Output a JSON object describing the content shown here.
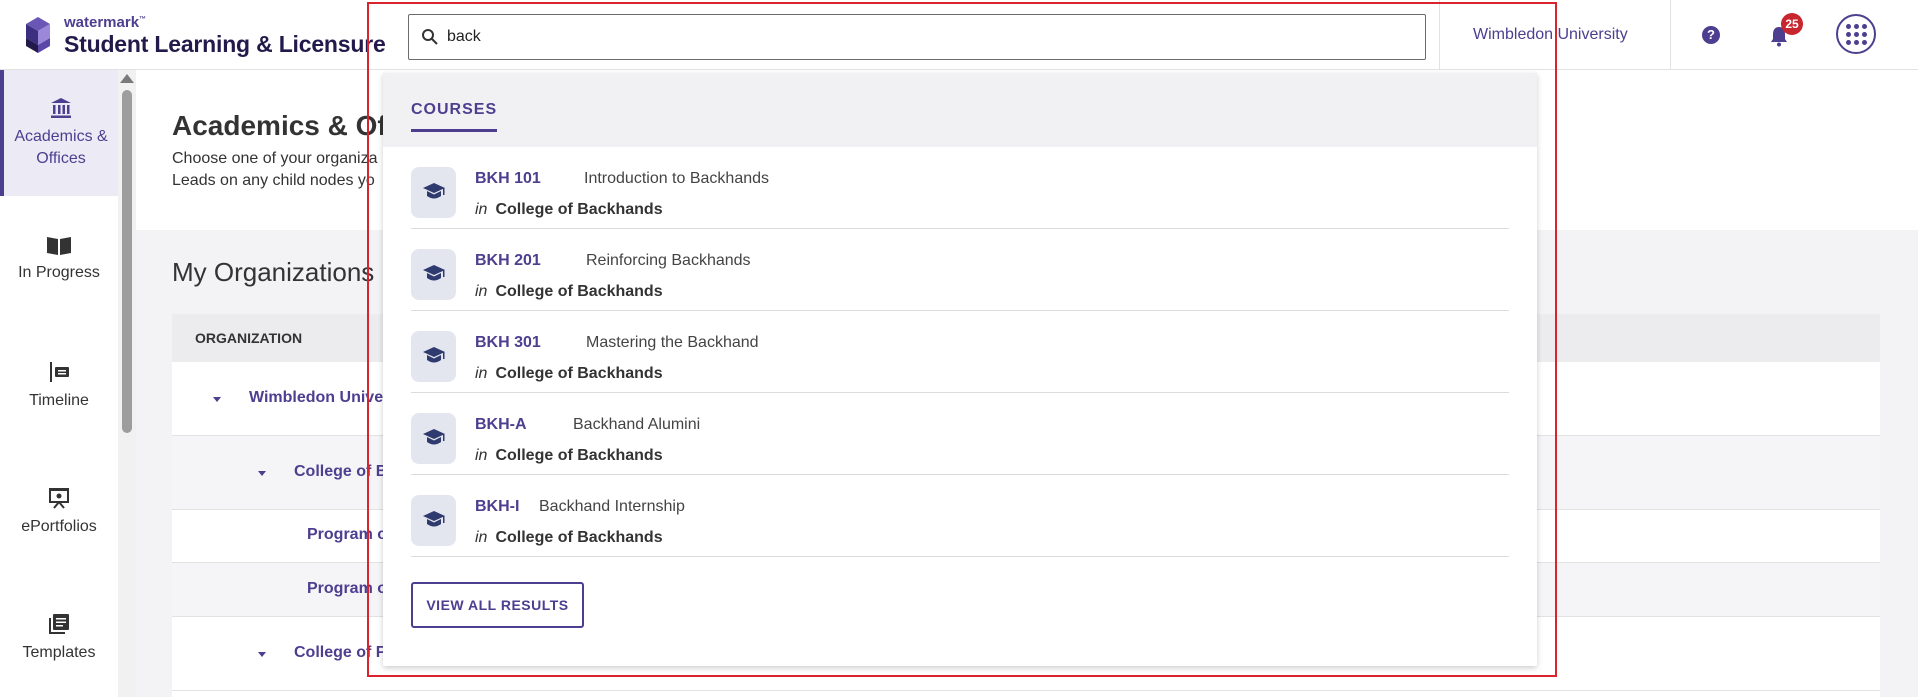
{
  "header": {
    "brand": "watermark",
    "brand_tm": "™",
    "product": "Student Learning & Licensure",
    "search_value": "back",
    "institution": "Wimbledon University",
    "help_icon": "question-circle-icon",
    "notification_count": "25",
    "apps_icon": "grid-apps-icon"
  },
  "sidebar": {
    "items": [
      {
        "label": "Academics & Offices",
        "icon": "institution-icon",
        "active": true
      },
      {
        "label": "In Progress",
        "icon": "open-book-icon"
      },
      {
        "label": "Timeline",
        "icon": "timeline-icon"
      },
      {
        "label": "ePortfolios",
        "icon": "presentation-icon"
      },
      {
        "label": "Templates",
        "icon": "templates-icon"
      }
    ]
  },
  "main": {
    "title": "Academics & Off",
    "description_line1": "Choose one of your organiza",
    "description_line2": "Leads on any child nodes yo",
    "section_title": "My Organizations",
    "table": {
      "header": "ORGANIZATION",
      "rows": [
        {
          "label": "Wimbledon Unive"
        },
        {
          "label": "College of B"
        },
        {
          "label": "Program o"
        },
        {
          "label": "Program o"
        },
        {
          "label": "College of F"
        }
      ]
    }
  },
  "dropdown": {
    "tab": "COURSES",
    "results": [
      {
        "code": "BKH 101",
        "title": "Introduction to Backhands",
        "in": "in",
        "org": "College of Backhands"
      },
      {
        "code": "BKH 201",
        "title": "Reinforcing Backhands",
        "in": "in",
        "org": "College of Backhands"
      },
      {
        "code": "BKH 301",
        "title": "Mastering the Backhand",
        "in": "in",
        "org": "College of Backhands"
      },
      {
        "code": "BKH-A",
        "title": "Backhand Alumini",
        "in": "in",
        "org": "College of Backhands"
      },
      {
        "code": "BKH-I",
        "title": "Backhand Internship",
        "in": "in",
        "org": "College of Backhands"
      }
    ],
    "view_all_label": "VIEW ALL RESULTS"
  },
  "colors": {
    "accent": "#4d3e8f",
    "badge": "#c8262f",
    "highlight_border": "#d9232d"
  }
}
